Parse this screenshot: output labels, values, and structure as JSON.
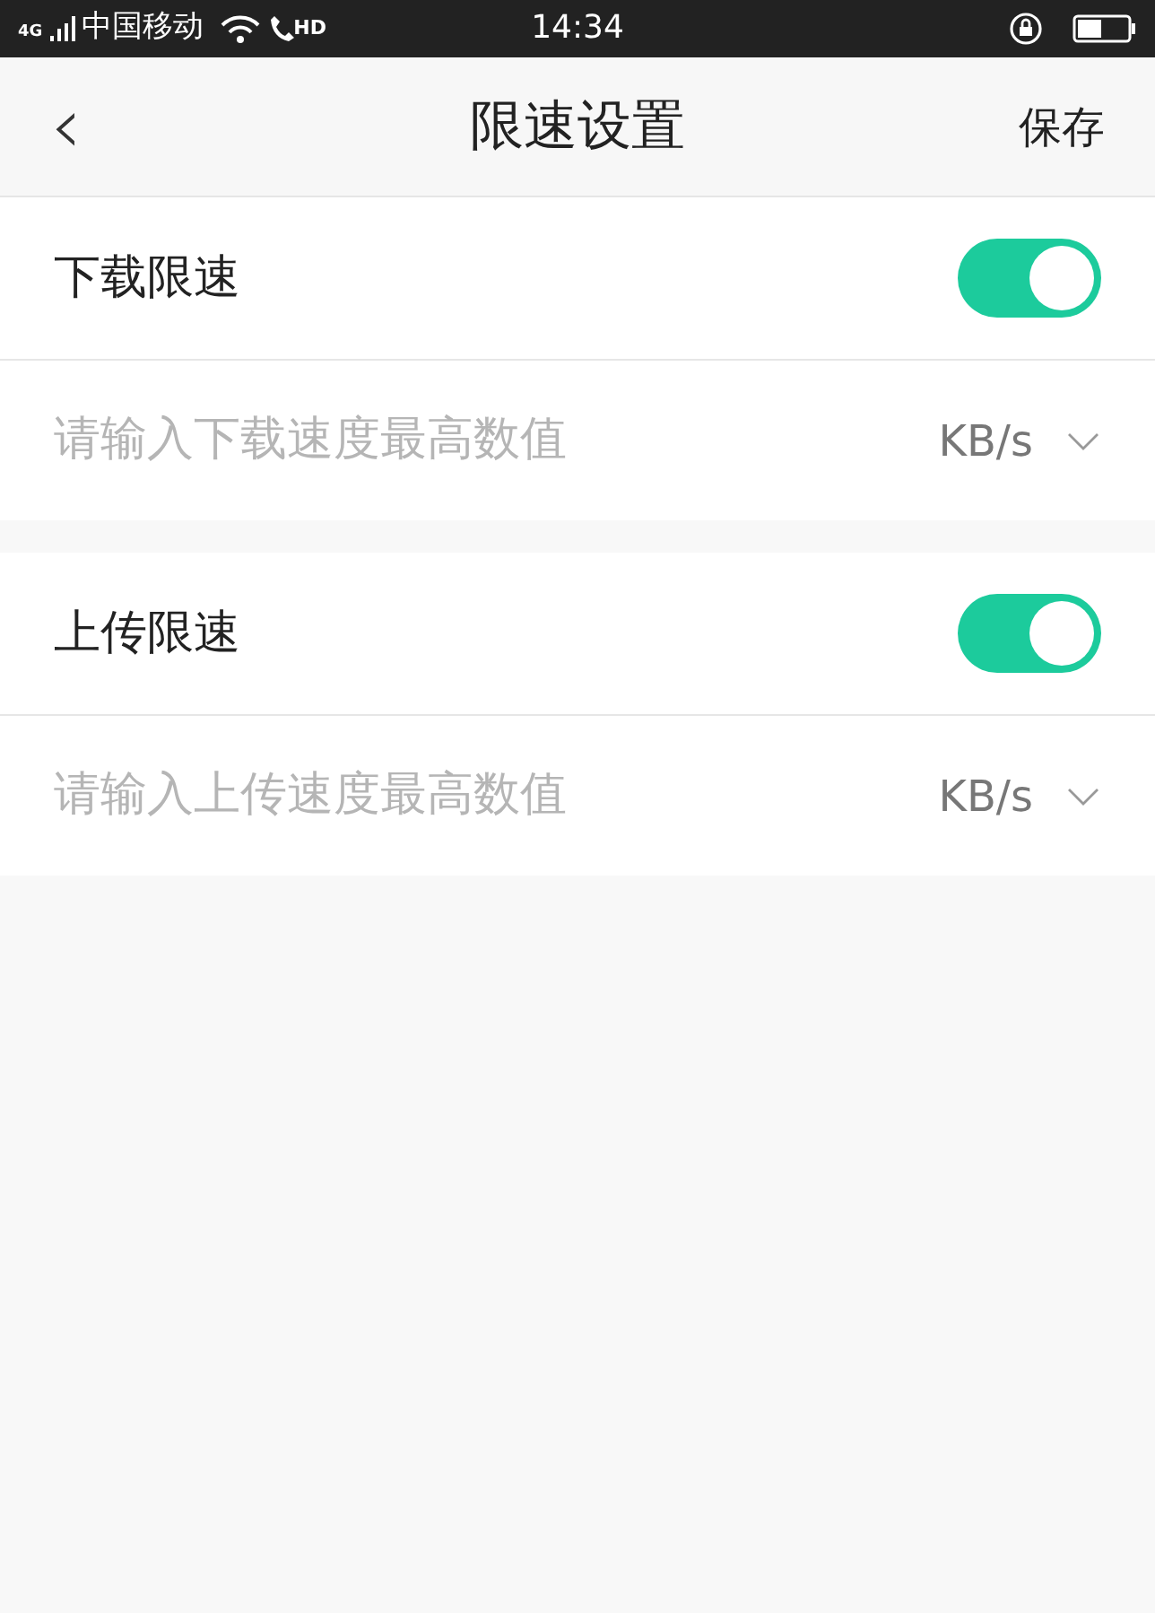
{
  "status_bar": {
    "network": "4G",
    "carrier": "中国移动",
    "call_badge": "HD",
    "time": "14:34"
  },
  "header": {
    "back": "‹",
    "title": "限速设置",
    "action": "保存"
  },
  "sections": [
    {
      "label": "下载限速",
      "on": true,
      "placeholder": "请输入下载速度最高数值",
      "unit": "KB/s"
    },
    {
      "label": "上传限速",
      "on": true,
      "placeholder": "请输入上传速度最高数值",
      "unit": "KB/s"
    }
  ]
}
